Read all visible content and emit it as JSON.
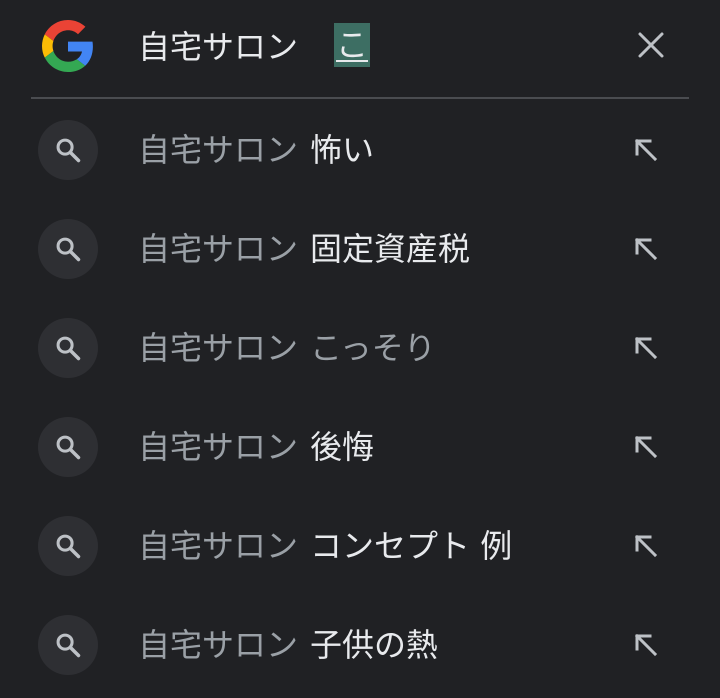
{
  "search": {
    "typed": "自宅サロン",
    "composing": "こ",
    "logo_icon": "google-g-logo",
    "clear_icon": "close-icon"
  },
  "suggestions": [
    {
      "prefix": "自宅サロン",
      "suffix": "怖い",
      "suffix_dim": false
    },
    {
      "prefix": "自宅サロン",
      "suffix": "固定資産税",
      "suffix_dim": false
    },
    {
      "prefix": "自宅サロン",
      "suffix": "こっそり",
      "suffix_dim": true
    },
    {
      "prefix": "自宅サロン",
      "suffix": "後悔",
      "suffix_dim": false
    },
    {
      "prefix": "自宅サロン",
      "suffix": "コンセプト 例",
      "suffix_dim": false
    },
    {
      "prefix": "自宅サロン",
      "suffix": "子供の熱",
      "suffix_dim": false
    }
  ],
  "colors": {
    "background": "#202124",
    "text_primary": "#e8eaed",
    "text_secondary": "#9aa0a6",
    "composing_highlight": "#3d6e63"
  }
}
